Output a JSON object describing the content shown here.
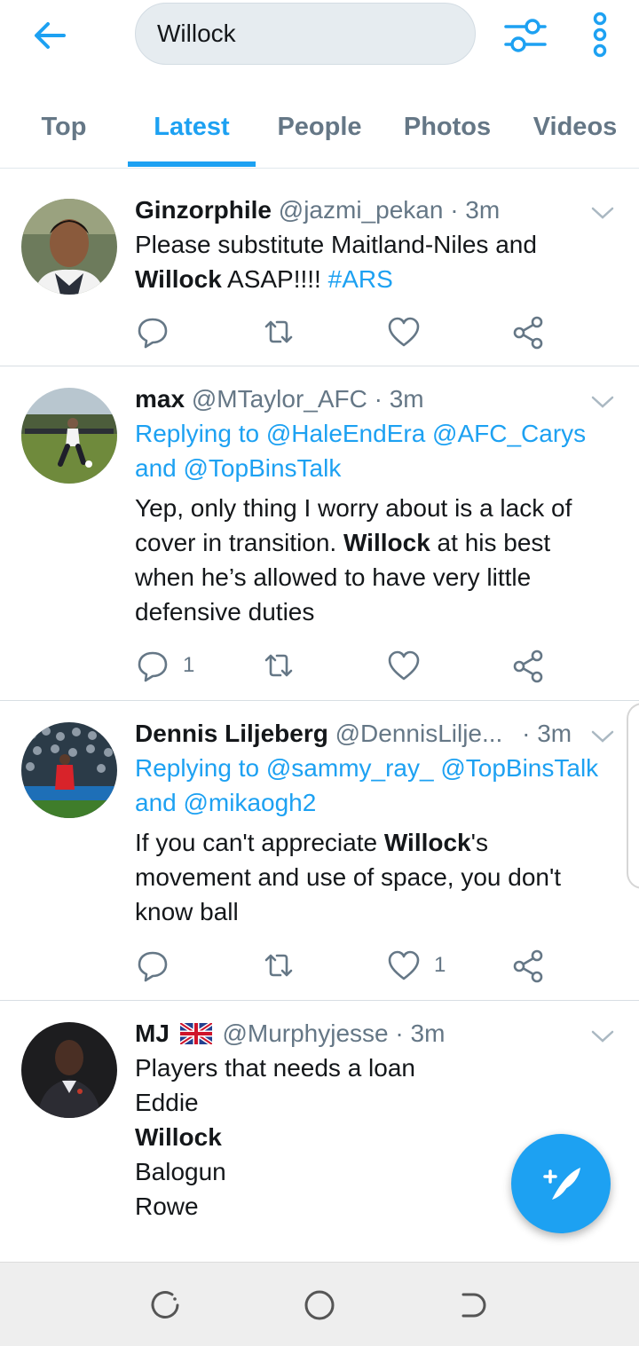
{
  "search": {
    "query": "Willock"
  },
  "tabs": [
    {
      "label": "Top"
    },
    {
      "label": "Latest"
    },
    {
      "label": "People"
    },
    {
      "label": "Photos"
    },
    {
      "label": "Videos"
    }
  ],
  "active_tab": "Latest",
  "colors": {
    "accent": "#1da1f2",
    "muted": "#657786",
    "text": "#14171a"
  },
  "tweets": [
    {
      "name": "Ginzorphile",
      "handle": "@jazmi_pekan",
      "time": "· 3m",
      "text_lines": [
        {
          "parts": [
            {
              "t": "Please substitute Maitland-Niles and",
              "s": "normal"
            }
          ]
        },
        {
          "parts": [
            {
              "t": "Willock",
              "s": "bold"
            },
            {
              "t": " ASAP!!!! ",
              "s": "normal"
            },
            {
              "t": "#ARS",
              "s": "blue"
            }
          ]
        }
      ],
      "replies": "",
      "retweets": "",
      "likes": ""
    },
    {
      "name": "max",
      "handle": "@MTaylor_AFC",
      "time": "· 3m",
      "reply_lines": [
        {
          "parts": [
            {
              "t": "Replying to ",
              "s": "blue"
            },
            {
              "t": "@HaleEndEra @AFC_Carys",
              "s": "blue"
            }
          ]
        },
        {
          "parts": [
            {
              "t": "and ",
              "s": "blue"
            },
            {
              "t": "@TopBinsTalk",
              "s": "blue"
            }
          ]
        }
      ],
      "text_lines": [
        {
          "parts": [
            {
              "t": "Yep, only thing I worry about is a lack of",
              "s": "normal"
            }
          ]
        },
        {
          "parts": [
            {
              "t": "cover in transition. ",
              "s": "normal"
            },
            {
              "t": "Willock",
              "s": "bold"
            },
            {
              "t": " at his best",
              "s": "normal"
            }
          ]
        },
        {
          "parts": [
            {
              "t": "when he’s allowed to have very little",
              "s": "normal"
            }
          ]
        },
        {
          "parts": [
            {
              "t": "defensive duties",
              "s": "normal"
            }
          ]
        }
      ],
      "replies": "1",
      "retweets": "",
      "likes": ""
    },
    {
      "name": "Dennis Liljeberg",
      "handle": "@DennisLilje...",
      "time": "· 3m",
      "reply_lines": [
        {
          "parts": [
            {
              "t": "Replying to ",
              "s": "blue"
            },
            {
              "t": "@sammy_ray_ @TopBinsTalk",
              "s": "blue"
            }
          ]
        },
        {
          "parts": [
            {
              "t": "and ",
              "s": "blue"
            },
            {
              "t": "@mikaogh2",
              "s": "blue"
            }
          ]
        }
      ],
      "text_lines": [
        {
          "parts": [
            {
              "t": "If you can't appreciate ",
              "s": "normal"
            },
            {
              "t": "Willock",
              "s": "bold"
            },
            {
              "t": "'s",
              "s": "normal"
            }
          ]
        },
        {
          "parts": [
            {
              "t": "movement and use of space, you don't",
              "s": "normal"
            }
          ]
        },
        {
          "parts": [
            {
              "t": "know ball",
              "s": "normal"
            }
          ]
        }
      ],
      "replies": "",
      "retweets": "",
      "likes": "1"
    },
    {
      "name": "MJ",
      "handle": "@Murphyjesse",
      "time": "· 3m",
      "text_lines": [
        {
          "parts": [
            {
              "t": "Players that needs a loan",
              "s": "normal"
            }
          ]
        },
        {
          "parts": [
            {
              "t": "Eddie",
              "s": "normal"
            }
          ]
        },
        {
          "parts": [
            {
              "t": "Willock",
              "s": "bold"
            }
          ]
        },
        {
          "parts": [
            {
              "t": "Balogun",
              "s": "normal"
            }
          ]
        },
        {
          "parts": [
            {
              "t": "Rowe",
              "s": "normal"
            }
          ]
        }
      ]
    }
  ],
  "icons": {
    "back": "arrow-left-icon",
    "filter": "sliders-icon",
    "more": "more-vertical-icon",
    "reply": "reply-icon",
    "retweet": "retweet-icon",
    "like": "heart-icon",
    "share": "share-icon",
    "compose": "compose-feather-icon",
    "flag": "uk-flag-icon"
  }
}
